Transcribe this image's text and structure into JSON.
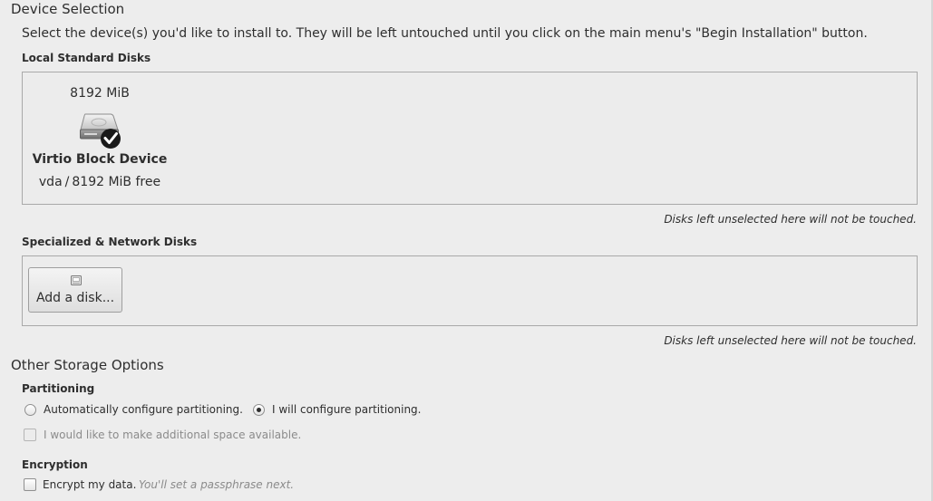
{
  "device_selection": {
    "title": "Device Selection",
    "intro": "Select the device(s) you'd like to install to.  They will be left untouched until you click on the main menu's \"Begin Installation\" button."
  },
  "local_disks": {
    "heading": "Local Standard Disks",
    "disks": [
      {
        "size": "8192 MiB",
        "name": "Virtio Block Device",
        "device": "vda",
        "separator": "/",
        "free": "8192 MiB free",
        "selected": true,
        "icon": "hard-disk-icon"
      }
    ],
    "note": "Disks left unselected here will not be touched."
  },
  "network_disks": {
    "heading": "Specialized & Network Disks",
    "add_button_label": "Add a disk...",
    "add_button_icon": "network-disk-icon",
    "note": "Disks left unselected here will not be touched."
  },
  "other_storage": {
    "title": "Other Storage Options",
    "partitioning": {
      "heading": "Partitioning",
      "options": [
        {
          "label": "Automatically configure partitioning.",
          "checked": false
        },
        {
          "label": "I will configure partitioning.",
          "checked": true
        }
      ],
      "reclaim_label": "I would like to make additional space available.",
      "reclaim_enabled": false,
      "reclaim_checked": false
    },
    "encryption": {
      "heading": "Encryption",
      "label": "Encrypt my data.",
      "hint": "You'll set a passphrase next.",
      "checked": false
    }
  }
}
